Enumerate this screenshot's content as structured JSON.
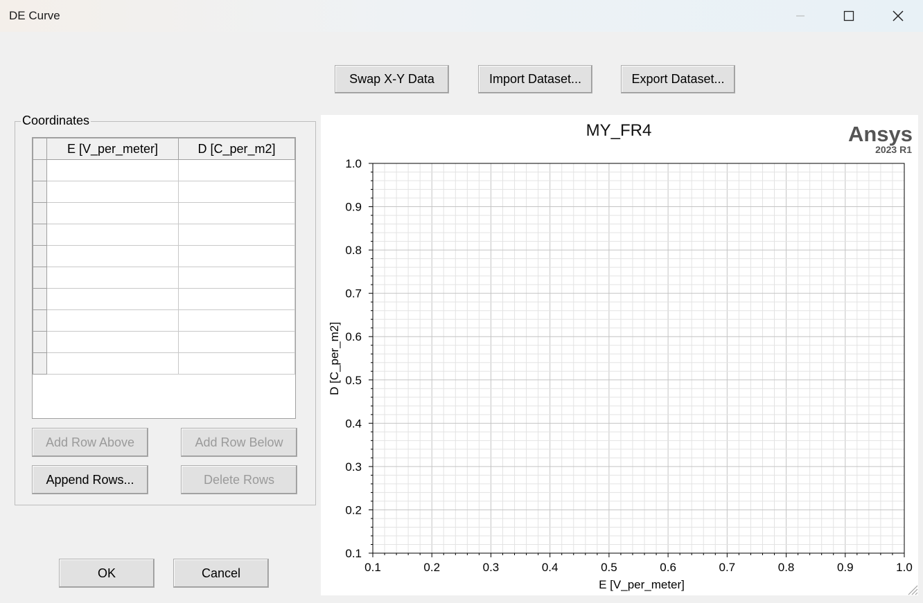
{
  "window": {
    "title": "DE Curve",
    "controls": [
      "minimize-icon",
      "maximize-icon",
      "close-icon"
    ]
  },
  "toolbar": {
    "swap": "Swap X-Y Data",
    "import": "Import Dataset...",
    "export": "Export Dataset..."
  },
  "coordinates": {
    "group_label": "Coordinates",
    "columns": [
      "E [V_per_meter]",
      "D [C_per_m2]"
    ],
    "rows": [
      [
        "",
        ""
      ],
      [
        "",
        ""
      ],
      [
        "",
        ""
      ],
      [
        "",
        ""
      ],
      [
        "",
        ""
      ],
      [
        "",
        ""
      ],
      [
        "",
        ""
      ],
      [
        "",
        ""
      ],
      [
        "",
        ""
      ],
      [
        "",
        ""
      ]
    ],
    "buttons": {
      "add_above": "Add Row Above",
      "add_below": "Add Row Below",
      "append": "Append Rows...",
      "delete": "Delete Rows"
    }
  },
  "footer": {
    "ok": "OK",
    "cancel": "Cancel"
  },
  "brand": {
    "name": "Ansys",
    "version": "2023 R1"
  },
  "colors": {
    "grid_minor": "#e3e3e3",
    "grid_major": "#c4c4c4",
    "axis": "#000000"
  },
  "chart_data": {
    "type": "line",
    "title": "MY_FR4",
    "xlabel": "E [V_per_meter]",
    "ylabel": "D [C_per_m2]",
    "xlim": [
      0.1,
      1.0
    ],
    "ylim": [
      0.1,
      1.0
    ],
    "x_ticks": [
      "0.1",
      "0.2",
      "0.3",
      "0.4",
      "0.5",
      "0.6",
      "0.7",
      "0.8",
      "0.9",
      "1.0"
    ],
    "y_ticks": [
      "0.1",
      "0.2",
      "0.3",
      "0.4",
      "0.5",
      "0.6",
      "0.7",
      "0.8",
      "0.9",
      "1.0"
    ],
    "grid": true,
    "series": []
  }
}
